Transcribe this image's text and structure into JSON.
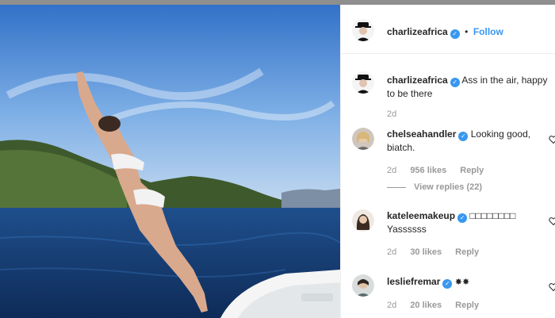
{
  "post": {
    "author": "charlizeafrica",
    "follow_separator": "•",
    "follow_label": "Follow",
    "caption_user": "charlizeafrica",
    "caption_text": "Ass in the air, happy to be there",
    "caption_age": "2d"
  },
  "comments": [
    {
      "user": "chelseahandler",
      "text": "Looking good, biatch.",
      "age": "2d",
      "likes": "956 likes",
      "reply": "Reply",
      "view_replies": "View replies (22)"
    },
    {
      "user": "kateleemakeup",
      "text_line1": "□□□□□□□□",
      "text_line2": "Yassssss",
      "age": "2d",
      "likes": "30 likes",
      "reply": "Reply"
    },
    {
      "user": "lesliefremar",
      "text": "✸✸",
      "age": "2d",
      "likes": "20 likes",
      "reply": "Reply"
    }
  ],
  "colors": {
    "link_blue": "#3897f0",
    "muted_gray": "#999999",
    "text_dark": "#262626"
  },
  "icons": [
    "verified-badge-icon",
    "heart-icon"
  ]
}
